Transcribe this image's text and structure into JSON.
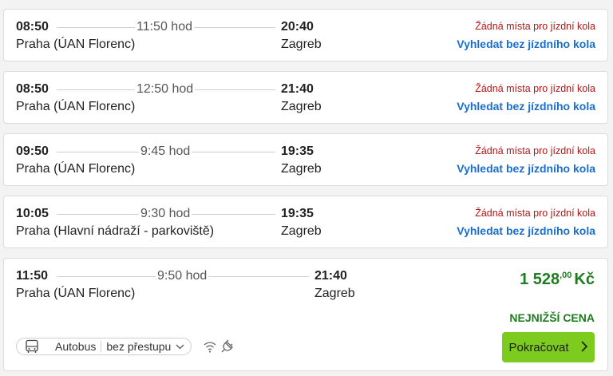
{
  "connections": [
    {
      "dep": "08:50",
      "from": "Praha (ÚAN Florenc)",
      "duration": "11:50 hod",
      "arr": "20:40",
      "to": "Zagreb",
      "notice": "Žádná místa pro jízdní kola",
      "link": "Vyhledat bez jízdního kola"
    },
    {
      "dep": "08:50",
      "from": "Praha (ÚAN Florenc)",
      "duration": "12:50 hod",
      "arr": "21:40",
      "to": "Zagreb",
      "notice": "Žádná místa pro jízdní kola",
      "link": "Vyhledat bez jízdního kola"
    },
    {
      "dep": "09:50",
      "from": "Praha (ÚAN Florenc)",
      "duration": "9:45 hod",
      "arr": "19:35",
      "to": "Zagreb",
      "notice": "Žádná místa pro jízdní kola",
      "link": "Vyhledat bez jízdního kola"
    },
    {
      "dep": "10:05",
      "from": "Praha (Hlavní nádraží - parkoviště)",
      "duration": "9:30 hod",
      "arr": "19:35",
      "to": "Zagreb",
      "notice": "Žádná místa pro jízdní kola",
      "link": "Vyhledat bez jízdního kola"
    }
  ],
  "featured": {
    "dep": "11:50",
    "from": "Praha (ÚAN Florenc)",
    "duration": "9:50 hod",
    "arr": "21:40",
    "to": "Zagreb",
    "price_main": "1 528",
    "price_decimals": ",00",
    "currency": "Kč",
    "cheapest_label": "NEJNIŽŠÍ CENA",
    "continue_label": "Pokračovat",
    "vehicle_label": "Autobus",
    "transfer_label": "bez přestupu",
    "icons": [
      "bus-icon",
      "wifi-icon",
      "power-outlet-icon"
    ]
  },
  "colors": {
    "price_green": "#1e7d1e",
    "button_green": "#7dcb1f",
    "notice_red": "#b01818",
    "link_blue": "#1a6fcc"
  }
}
